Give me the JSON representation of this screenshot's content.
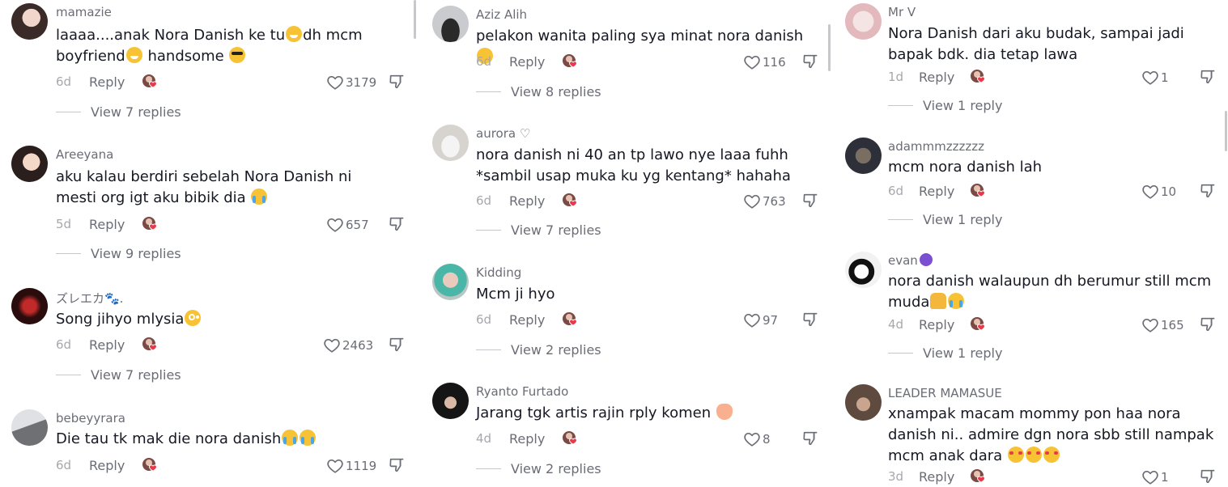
{
  "icons": {
    "like": "heart-outline-icon",
    "dislike": "thumbs-down-icon"
  },
  "colors": {
    "text": "#161823",
    "muted": "#6b6d76",
    "faint": "#a7a8ad"
  },
  "columns": [
    {
      "comments": [
        {
          "username": "mamazie",
          "text": [
            "laaaa....anak Nora Danish ke tu",
            "dh mcm",
            "boyfriend",
            " handsome "
          ],
          "age": "6d",
          "reply": "Reply",
          "likes": "3179",
          "replies": "View 7 replies"
        },
        {
          "username": "Areeyana",
          "text": [
            "aku kalau berdiri sebelah Nora Danish ni mesti org igt aku bibik dia "
          ],
          "age": "5d",
          "reply": "Reply",
          "likes": "657",
          "replies": "View 9 replies"
        },
        {
          "username": "ズレエカ🐾.",
          "text": [
            "Song jihyo mlysia"
          ],
          "age": "6d",
          "reply": "Reply",
          "likes": "2463",
          "replies": "View 7 replies"
        },
        {
          "username": "bebeyyrara",
          "text": [
            "Die tau tk mak die nora danish"
          ],
          "age": "6d",
          "reply": "Reply",
          "likes": "1119",
          "replies": ""
        }
      ]
    },
    {
      "comments": [
        {
          "username": "Aziz Alih",
          "text": [
            "pelakon wanita paling sya minat nora danish "
          ],
          "age": "6d",
          "reply": "Reply",
          "likes": "116",
          "replies": "View 8 replies"
        },
        {
          "username": "aurora ♡",
          "text": [
            "nora danish ni 40 an tp lawo nye laaa fuhh *sambil usap muka ku yg kentang* hahaha"
          ],
          "age": "6d",
          "reply": "Reply",
          "likes": "763",
          "replies": "View 7 replies"
        },
        {
          "username": "Kidding",
          "text": [
            "Mcm ji hyo"
          ],
          "age": "6d",
          "reply": "Reply",
          "likes": "97",
          "replies": "View 2 replies"
        },
        {
          "username": "Ryanto Furtado",
          "text": [
            "Jarang tgk artis rajin rply komen "
          ],
          "age": "4d",
          "reply": "Reply",
          "likes": "8",
          "replies": "View 2 replies"
        }
      ]
    },
    {
      "comments": [
        {
          "username": "Mr V",
          "text": [
            "Nora Danish dari aku budak, sampai jadi bapak bdk. dia tetap lawa"
          ],
          "age": "1d",
          "reply": "Reply",
          "likes": "1",
          "replies": "View 1 reply"
        },
        {
          "username": "adammmzzzzzz",
          "text": [
            "mcm nora danish lah"
          ],
          "age": "6d",
          "reply": "Reply",
          "likes": "10",
          "replies": "View 1 reply"
        },
        {
          "username": "evan",
          "text": [
            "nora danish walaupun dh berumur still mcm muda"
          ],
          "age": "4d",
          "reply": "Reply",
          "likes": "165",
          "replies": "View 1 reply"
        },
        {
          "username": "LEADER MAMASUE",
          "text": [
            "xnampak macam mommy pon haa nora danish ni.. admire dgn nora sbb still nampak mcm anak dara "
          ],
          "age": "3d",
          "reply": "Reply",
          "likes": "1",
          "replies": ""
        }
      ]
    }
  ]
}
